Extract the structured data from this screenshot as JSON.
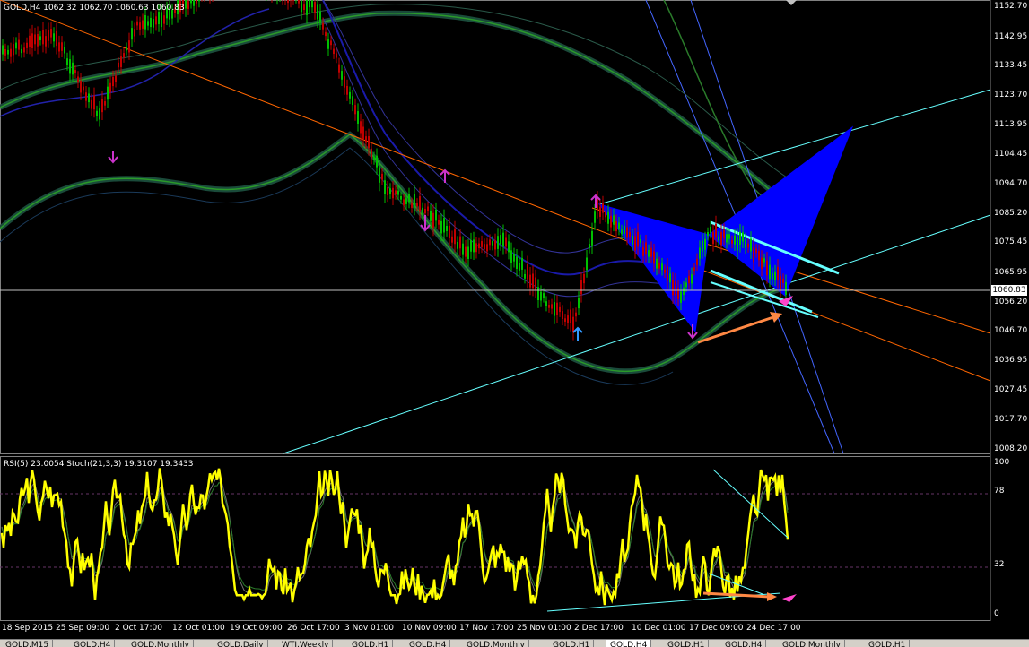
{
  "window": {
    "main_label": "GOLD,H4",
    "ohlc": "1062.32 1062.70 1060.63 1060.83",
    "indicator_label": "RSI(5) 23.0054  Stoch(21,3,3) 19.3107 19.3433",
    "current_price": "1060.83"
  },
  "price_axis": [
    "1152.70",
    "1142.95",
    "1133.45",
    "1123.70",
    "1113.95",
    "1104.45",
    "1094.70",
    "1085.20",
    "1075.45",
    "1065.95",
    "1056.20",
    "1046.70",
    "1036.95",
    "1027.45",
    "1017.70",
    "1008.20"
  ],
  "indicator_axis": [
    "100",
    "78",
    "32",
    "0"
  ],
  "time_axis": [
    "18 Sep 2015",
    "25 Sep 09:00",
    "2 Oct 17:00",
    "12 Oct 01:00",
    "19 Oct 09:00",
    "26 Oct 17:00",
    "3 Nov 01:00",
    "10 Nov 09:00",
    "17 Nov 17:00",
    "25 Nov 01:00",
    "2 Dec 17:00",
    "10 Dec 01:00",
    "17 Dec 09:00",
    "24 Dec 17:00"
  ],
  "tabs": [
    "GOLD,M15",
    "GOLD,H4",
    "GOLD,Monthly",
    "GOLD,Daily",
    "WTI,Weekly",
    "GOLD,H1",
    "GOLD,H4",
    "GOLD,Monthly",
    "GOLD,H1",
    "GOLD,H4",
    "GOLD,H1",
    "GOLD,H4",
    "GOLD,Monthly",
    "GOLD,H1"
  ],
  "active_tab_index": 9,
  "colors": {
    "background": "#000000",
    "candle_up": "#00c000",
    "candle_down": "#c00000",
    "pattern_fill": "#0000ff",
    "rsi": "#ffff00",
    "trendline": "#ff6600",
    "channel": "#66ffff",
    "arrow": "#ff8844",
    "marker": "#ff44cc"
  },
  "icons": [
    "up-arrow-marker-icon",
    "down-arrow-marker-icon"
  ]
}
